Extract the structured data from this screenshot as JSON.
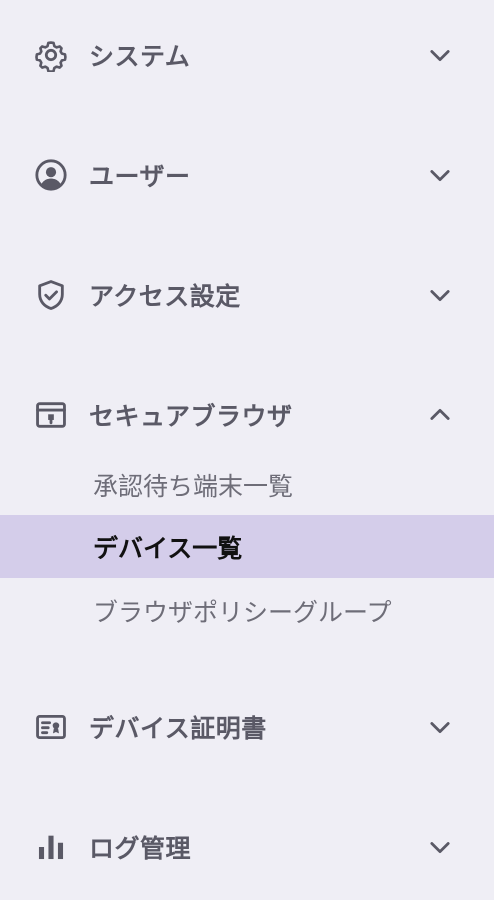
{
  "menu": {
    "sections": [
      {
        "label": "システム",
        "icon": "gear-icon",
        "chevron": "chevron-down-icon"
      },
      {
        "label": "ユーザー",
        "icon": "user-circle-icon",
        "chevron": "chevron-down-icon"
      },
      {
        "label": "アクセス設定",
        "icon": "shield-check-icon",
        "chevron": "chevron-down-icon"
      },
      {
        "label": "セキュアブラウザ",
        "icon": "browser-window-icon",
        "chevron": "chevron-up-icon"
      },
      {
        "label": "デバイス証明書",
        "icon": "certificate-card-icon",
        "chevron": "chevron-down-icon"
      },
      {
        "label": "ログ管理",
        "icon": "bar-chart-icon",
        "chevron": "chevron-down-icon"
      }
    ],
    "secure_browser_items": [
      {
        "label": "承認待ち端末一覧",
        "active": false
      },
      {
        "label": "デバイス一覧",
        "active": true
      },
      {
        "label": "ブラウザポリシーグループ",
        "active": false
      }
    ]
  },
  "colors": {
    "background": "#efeef5",
    "active_background": "#d4cdea",
    "text": "#5a5966",
    "active_text": "#111111"
  }
}
